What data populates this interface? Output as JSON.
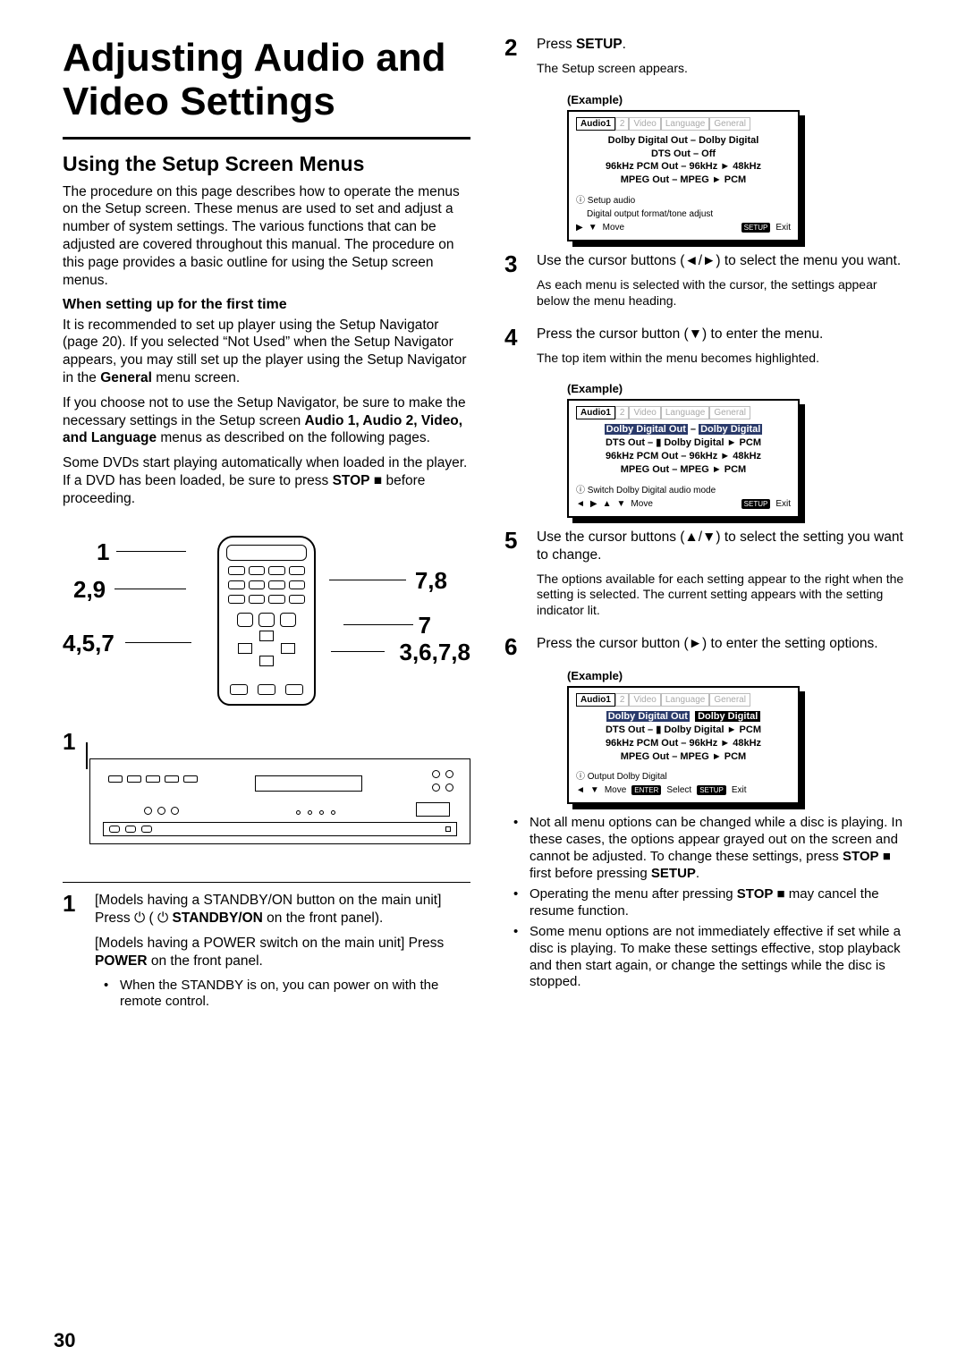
{
  "page_number": "30",
  "title": "Adjusting Audio and Video Settings",
  "section": "Using the Setup Screen Menus",
  "intro": "The procedure on this page describes how to operate the menus on the Setup screen. These menus are used to set and adjust a number of system settings. The various functions that can be adjusted are covered throughout this manual. The procedure on this page provides a basic outline for using the Setup screen menus.",
  "first_time_heading": "When setting up for the first time",
  "first_time_p1a": "It is recommended to set up player using the Setup Navigator (page 20). If you selected “Not Used” when the Setup Navigator appears, you may still set up the player using the Setup Navigator in the ",
  "first_time_p1b": " menu screen.",
  "first_time_general": "General",
  "first_time_p2a": "If you choose not to use the Setup Navigator, be sure to make the necessary settings in the Setup screen ",
  "menus_list": "Audio 1, Audio 2, Video, and Language",
  "first_time_p2b": " menus as described on the following pages.",
  "first_time_p3a": "Some DVDs start playing automatically when loaded in the player. If a DVD has been loaded, be sure to press ",
  "stop_word": "STOP",
  "first_time_p3b": " ■ before proceeding.",
  "diagram_labels": {
    "l1": "1",
    "l2": "2,9",
    "l3": "4,5,7",
    "r1": "7,8",
    "r2": "7",
    "r3": "3,6,7,8",
    "player_call": "1"
  },
  "steps": {
    "s1": {
      "num": "1",
      "p1a": "[Models having a STANDBY/ON button on the main unit] Press ",
      "p1b": " STANDBY/ON",
      "p1c": " on the front panel).",
      "p2a": "[Models having a POWER switch on the main unit] Press ",
      "p2b": "POWER",
      "p2c": " on the front panel.",
      "bul": "When the STANDBY is on, you can power on with the remote control."
    },
    "s2": {
      "num": "2",
      "line_a": "Press ",
      "setup": "SETUP",
      "line_b": ".",
      "sub": "The Setup screen appears.",
      "example": "(Example)"
    },
    "s3": {
      "num": "3",
      "main": "Use the cursor buttons (◄/►) to select the menu you want.",
      "sub": "As each menu is selected with the cursor, the settings appear below the menu heading."
    },
    "s4": {
      "num": "4",
      "main": "Press the cursor button (▼) to enter the menu.",
      "sub": "The top item within the menu becomes highlighted.",
      "example": "(Example)"
    },
    "s5": {
      "num": "5",
      "main": "Use the cursor buttons (▲/▼) to select the setting you want to change.",
      "sub": "The options available for each setting appear to the right when the setting is selected. The current setting appears with the setting indicator lit."
    },
    "s6": {
      "num": "6",
      "main": "Press the cursor button (►) to enter the setting options.",
      "example": "(Example)"
    }
  },
  "osd1": {
    "tabs": [
      "Audio1",
      "2",
      "Video",
      "Language",
      "General"
    ],
    "l1": "Dolby Digital Out – Dolby Digital",
    "l2": "DTS Out – Off",
    "l3": "96kHz PCM Out – 96kHz ► 48kHz",
    "l4": "MPEG Out – MPEG ► PCM",
    "info1": "Setup audio",
    "info2": "Digital output format/tone adjust",
    "move": "Move",
    "setup": "SETUP",
    "exit": "Exit"
  },
  "osd2": {
    "hl": "Dolby Digital Out",
    "hlv": "Dolby Digital",
    "l2": "DTS Out – ▮ Dolby Digital ► PCM",
    "l3": "96kHz PCM Out – 96kHz ► 48kHz",
    "l4": "MPEG Out – MPEG ► PCM",
    "info": "Switch Dolby Digital audio mode",
    "move": "Move",
    "setup": "SETUP",
    "exit": "Exit"
  },
  "osd3": {
    "hl": "Dolby Digital Out",
    "hlv": "Dolby Digital",
    "l2": "DTS Out – ▮ Dolby Digital ► PCM",
    "l3": "96kHz PCM Out – 96kHz ► 48kHz",
    "l4": "MPEG Out – MPEG ► PCM",
    "info": "Output Dolby Digital",
    "move": "Move",
    "enter": "ENTER",
    "select": "Select",
    "setup": "SETUP",
    "exit": "Exit"
  },
  "notes": {
    "n1a": "Not all menu options can be changed while a disc is playing. In these cases, the options appear grayed out on the screen and cannot be adjusted. To change these settings, press ",
    "n1b": " ■ first before pressing ",
    "n1_setup": "SETUP",
    "n1c": ".",
    "n2a": "Operating the menu after pressing ",
    "n2b": " ■ may cancel the resume function.",
    "n3": "Some menu options are not immediately effective if set while a disc is playing. To make these settings effective, stop playback and then start again, or change the settings while the disc is stopped."
  }
}
